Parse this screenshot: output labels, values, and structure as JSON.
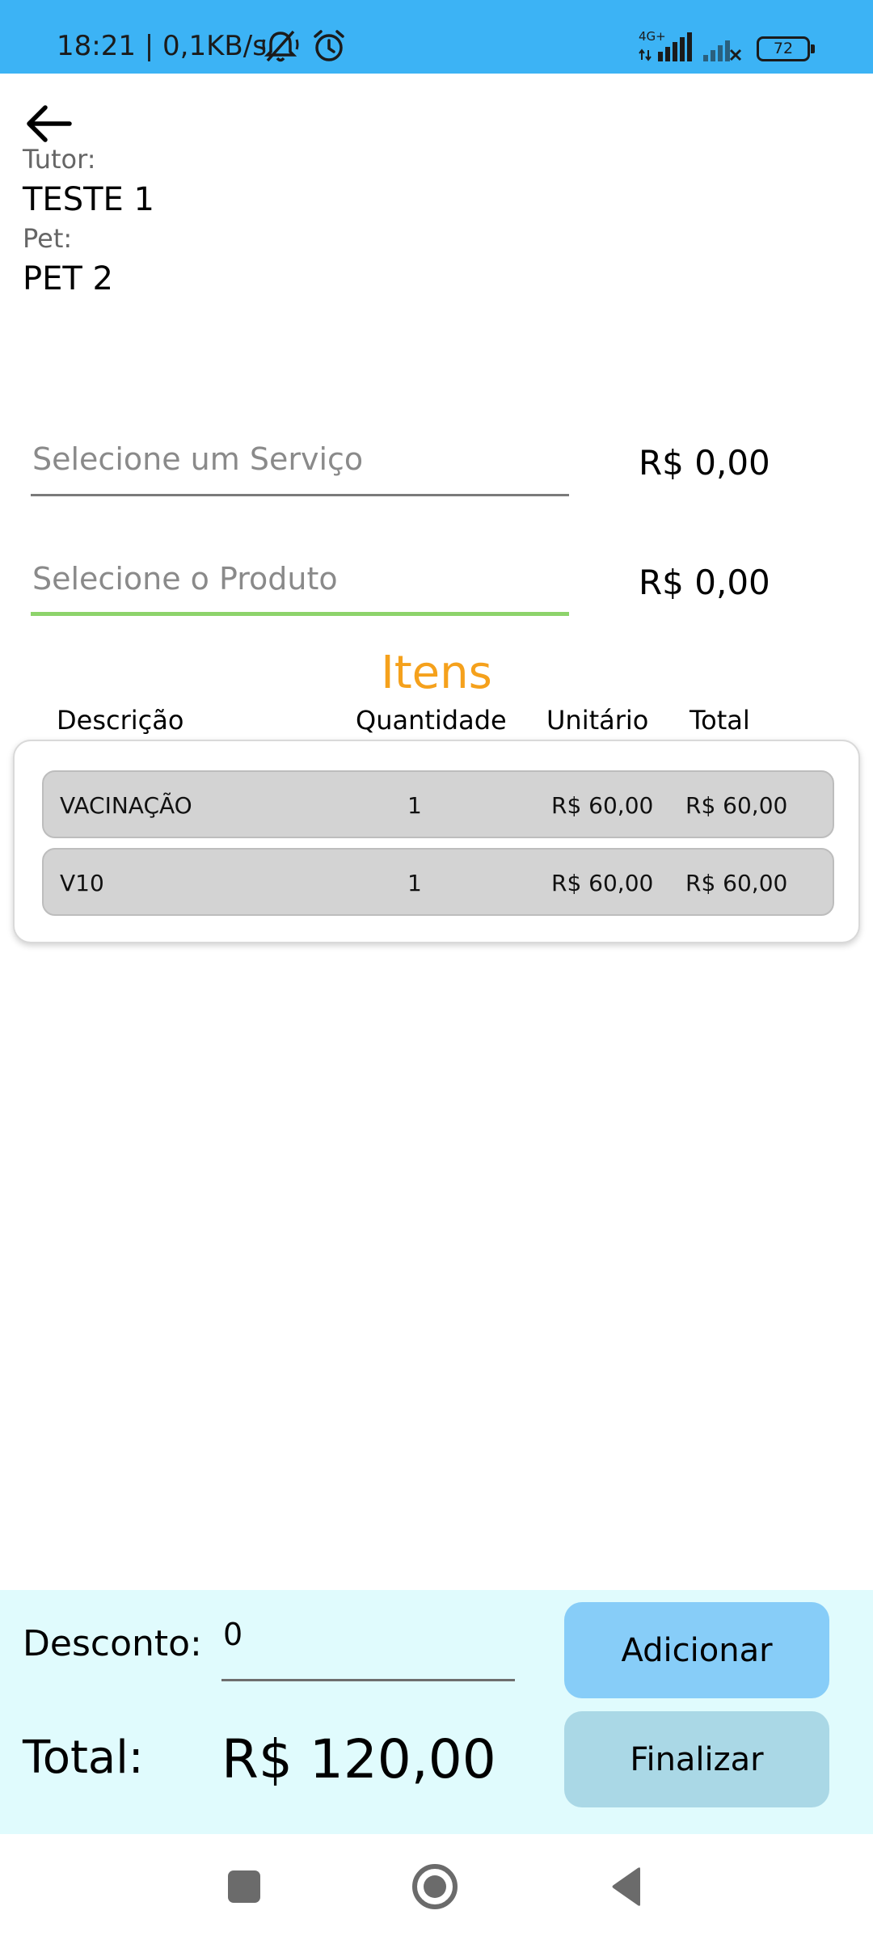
{
  "status_bar": {
    "time_text": "18:21 | 0,1KB/s",
    "network_type": "4G+",
    "battery": "72",
    "icons": [
      "bell-muted-icon",
      "alarm-icon",
      "signal-4g-icon",
      "signal-no-service-icon",
      "battery-icon"
    ]
  },
  "header": {
    "back_icon": "arrow-left-icon",
    "tutor_label": "Tutor:",
    "tutor_value": "TESTE 1",
    "pet_label": "Pet:",
    "pet_value": "PET 2"
  },
  "service": {
    "placeholder": "Selecione um Serviço",
    "price": "R$ 0,00"
  },
  "product": {
    "placeholder": "Selecione o Produto",
    "price": "R$ 0,00"
  },
  "items": {
    "title": "Itens",
    "columns": {
      "description": "Descrição",
      "quantity": "Quantidade",
      "unit": "Unitário",
      "total": "Total"
    },
    "rows": [
      {
        "description": "VACINAÇÃO",
        "quantity": "1",
        "unit": "R$ 60,00",
        "total": "R$ 60,00"
      },
      {
        "description": "V10",
        "quantity": "1",
        "unit": "R$ 60,00",
        "total": "R$ 60,00"
      }
    ]
  },
  "footer": {
    "discount_label": "Desconto:",
    "discount_value": "0",
    "total_label": "Total:",
    "total_value": "R$ 120,00",
    "add_button": "Adicionar",
    "finish_button": "Finalizar"
  },
  "nav": {
    "icons": [
      "recent-apps-icon",
      "home-icon",
      "back-triangle-icon"
    ]
  },
  "colors": {
    "status_bar": "#3cb3f5",
    "accent_orange": "#f5a11c",
    "focus_green": "#8dd36b",
    "bottom_panel": "#e0fbfd",
    "add_button": "#87cdf8",
    "finish_button": "#aad8e6"
  }
}
